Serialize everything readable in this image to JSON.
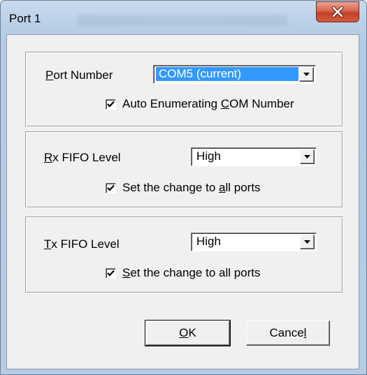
{
  "window": {
    "title": "Port 1",
    "close_glyph": "✕"
  },
  "port_group": {
    "label_mnemonic": "P",
    "label_rest": "ort Number",
    "combo_value": "COM5 (current)",
    "checkbox_checked": true,
    "checkbox_pre": "Auto Enumerating ",
    "checkbox_mnemonic": "C",
    "checkbox_post": "OM Number"
  },
  "rx_group": {
    "label_mnemonic": "R",
    "label_rest": "x FIFO Level",
    "combo_value": "High",
    "checkbox_checked": true,
    "checkbox_pre": "Set the change to ",
    "checkbox_mnemonic": "a",
    "checkbox_post": "ll ports"
  },
  "tx_group": {
    "label_mnemonic": "T",
    "label_rest": "x FIFO Level",
    "combo_value": "High",
    "checkbox_checked": true,
    "checkbox_pre": "",
    "checkbox_mnemonic": "S",
    "checkbox_post": "et the change to all ports"
  },
  "buttons": {
    "ok_mnemonic": "O",
    "ok_rest": "K",
    "cancel_pre": "Cance",
    "cancel_mnemonic": "l"
  },
  "icons": {
    "close": "close-icon",
    "dropdown": "chevron-down-icon",
    "checkmark": "checkmark-icon"
  }
}
